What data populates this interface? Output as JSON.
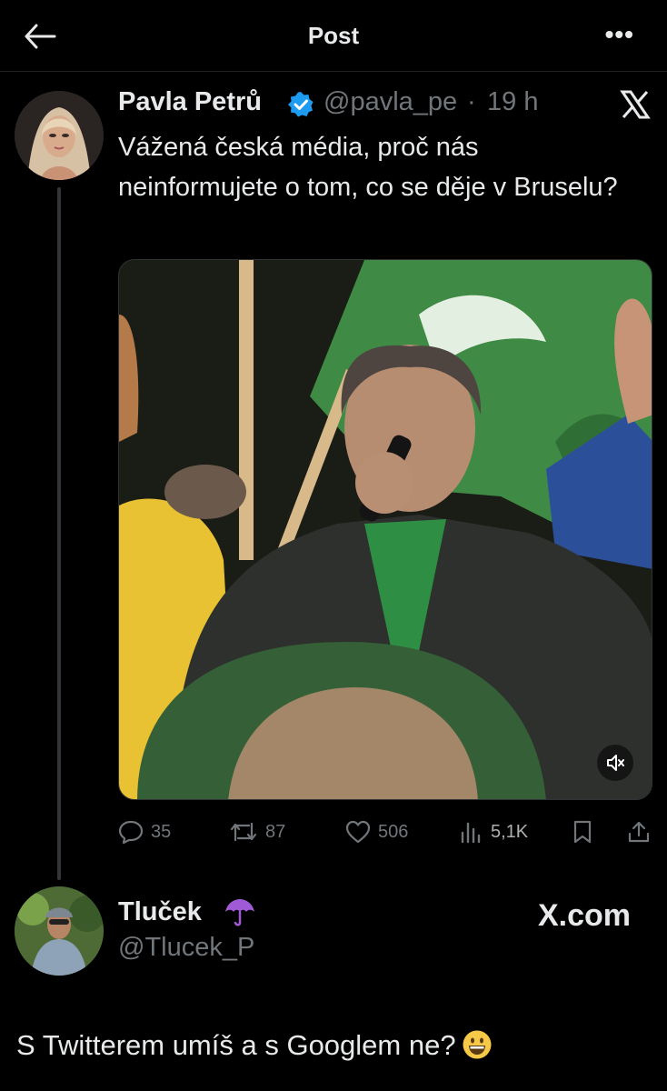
{
  "header": {
    "title": "Post",
    "back_icon": "arrow-left-icon",
    "more_icon": "more-horizontal-icon",
    "more_label": "•••"
  },
  "tweet": {
    "author_name": "Pavla Petrů",
    "verified": true,
    "handle": "@pavla_pe",
    "separator": "·",
    "time": "19 h",
    "text": "Vážená česká média, proč nás neinformujete o tom, co se děje v Bruselu?",
    "media": {
      "muted": true,
      "icon": "speaker-muted-icon"
    },
    "actions": {
      "replies": "35",
      "reposts": "87",
      "likes": "506",
      "views": "5,1K"
    },
    "platform_logo": "x-logo"
  },
  "reply": {
    "author_name": "Tluček",
    "name_emoji": "umbrella-emoji",
    "handle": "@Tlucek_P",
    "watermark": "X.com"
  },
  "caption": {
    "text": "S Twitterem umíš a s Googlem ne?",
    "emoji": "grinning-face-emoji"
  },
  "colors": {
    "background": "#000000",
    "text": "#e7e9ea",
    "secondary": "#71767b",
    "verified": "#1d9bf0",
    "thread_line": "#333639"
  }
}
